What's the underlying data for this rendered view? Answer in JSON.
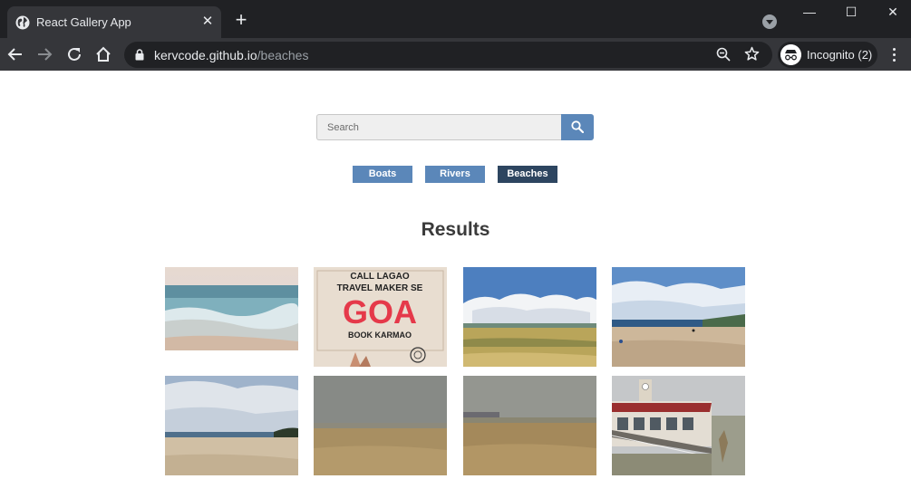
{
  "browser": {
    "tab_title": "React Gallery App",
    "tab_close": "✕",
    "new_tab": "+",
    "url_host": "kervcode.github.io",
    "url_path": "/beaches",
    "incognito_label": "Incognito (2)",
    "window_controls": {
      "minimize": "—",
      "maximize": "☐",
      "close": "✕"
    }
  },
  "search": {
    "placeholder": "Search"
  },
  "nav": [
    {
      "label": "Boats",
      "active": false
    },
    {
      "label": "Rivers",
      "active": false
    },
    {
      "label": "Beaches",
      "active": true
    }
  ],
  "results": {
    "title": "Results",
    "photos": [
      {
        "name": "photo-waves-shore",
        "lines": []
      },
      {
        "name": "photo-goa-poster",
        "lines": [
          "CALL LAGAO",
          "TRAVEL MAKER SE",
          "GOA",
          "BOOK KARMAO"
        ]
      },
      {
        "name": "photo-tidal-flats",
        "lines": []
      },
      {
        "name": "photo-sunny-beach",
        "lines": []
      },
      {
        "name": "photo-cloudy-beach",
        "lines": []
      },
      {
        "name": "photo-foggy-beach",
        "lines": []
      },
      {
        "name": "photo-hazy-beach-pier",
        "lines": []
      },
      {
        "name": "photo-pier-building",
        "lines": []
      }
    ]
  },
  "colors": {
    "button": "#5b87b9",
    "button_active": "#2d4560",
    "chrome_dark": "#202124",
    "chrome_toolbar": "#35363a"
  }
}
